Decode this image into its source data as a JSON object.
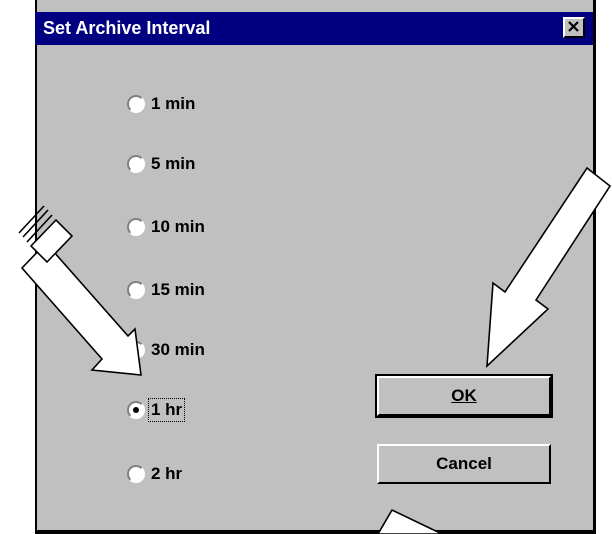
{
  "dialog": {
    "title": "Set Archive Interval",
    "close_symbol": "✕"
  },
  "options": [
    {
      "label": "1 min",
      "selected": false
    },
    {
      "label": "5 min",
      "selected": false
    },
    {
      "label": "10 min",
      "selected": false
    },
    {
      "label": "15 min",
      "selected": false
    },
    {
      "label": "30 min",
      "selected": false
    },
    {
      "label": "1 hr",
      "selected": true
    },
    {
      "label": "2 hr",
      "selected": false
    }
  ],
  "buttons": {
    "ok_label": "OK",
    "cancel_label": "Cancel"
  },
  "colors": {
    "titlebar": "#000080",
    "face": "#c0c0c0"
  }
}
